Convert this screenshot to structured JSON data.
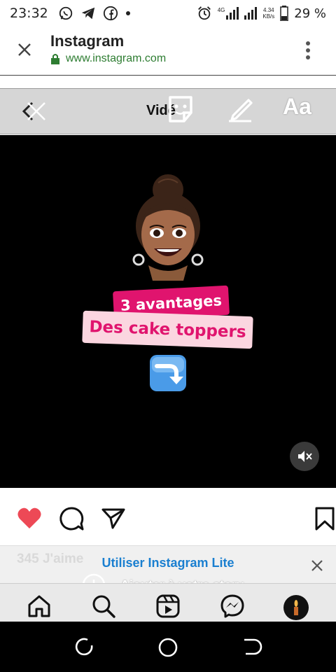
{
  "status_bar": {
    "time": "23:32",
    "left_icons": [
      "whatsapp-icon",
      "telegram-icon",
      "facebook-icon",
      "dot-icon"
    ],
    "right_icons": [
      "alarm-icon",
      "signal-4g-icon",
      "signal-icon"
    ],
    "network_type": "4G",
    "net_speed_value": "4.34",
    "net_speed_unit": "KB/s",
    "battery_percent": "29 %"
  },
  "browser": {
    "title": "Instagram",
    "url": "www.instagram.com",
    "close_icon": "close-icon",
    "lock_icon": "lock-icon",
    "menu_icon": "more-vertical-icon",
    "secure_color": "#2e7d32"
  },
  "story_editor": {
    "title": "Vidé",
    "text_tool_label": "Aa",
    "back_icon": "back-close-icon",
    "sticker_icon": "sticker-icon",
    "pen_icon": "pen-icon"
  },
  "video": {
    "sticker_line_1": "3 avantages",
    "sticker_line_2": "Des cake toppers",
    "emoji": "arrow-right-curving-down-icon",
    "mute_icon": "muted-speaker-icon",
    "accent_color": "#e0146e",
    "accent_light": "#fbd6e0"
  },
  "actions": {
    "like_icon": "heart-icon",
    "comment_icon": "comment-icon",
    "share_icon": "send-icon",
    "save_icon": "bookmark-icon",
    "like_color": "#ed4956"
  },
  "banner": {
    "likes_ghost": "345 J'aime",
    "lite_text": "Utiliser Instagram Lite",
    "story_text": "Ajouter à votre story",
    "close_icon": "close-icon",
    "lite_color": "#1a7fd0"
  },
  "bottom_nav": {
    "items": [
      "home-icon",
      "search-icon",
      "reels-icon",
      "messenger-icon",
      "profile-avatar"
    ]
  },
  "system_nav": {
    "items": [
      "recent-apps-icon",
      "home-circle-icon",
      "back-icon"
    ]
  }
}
